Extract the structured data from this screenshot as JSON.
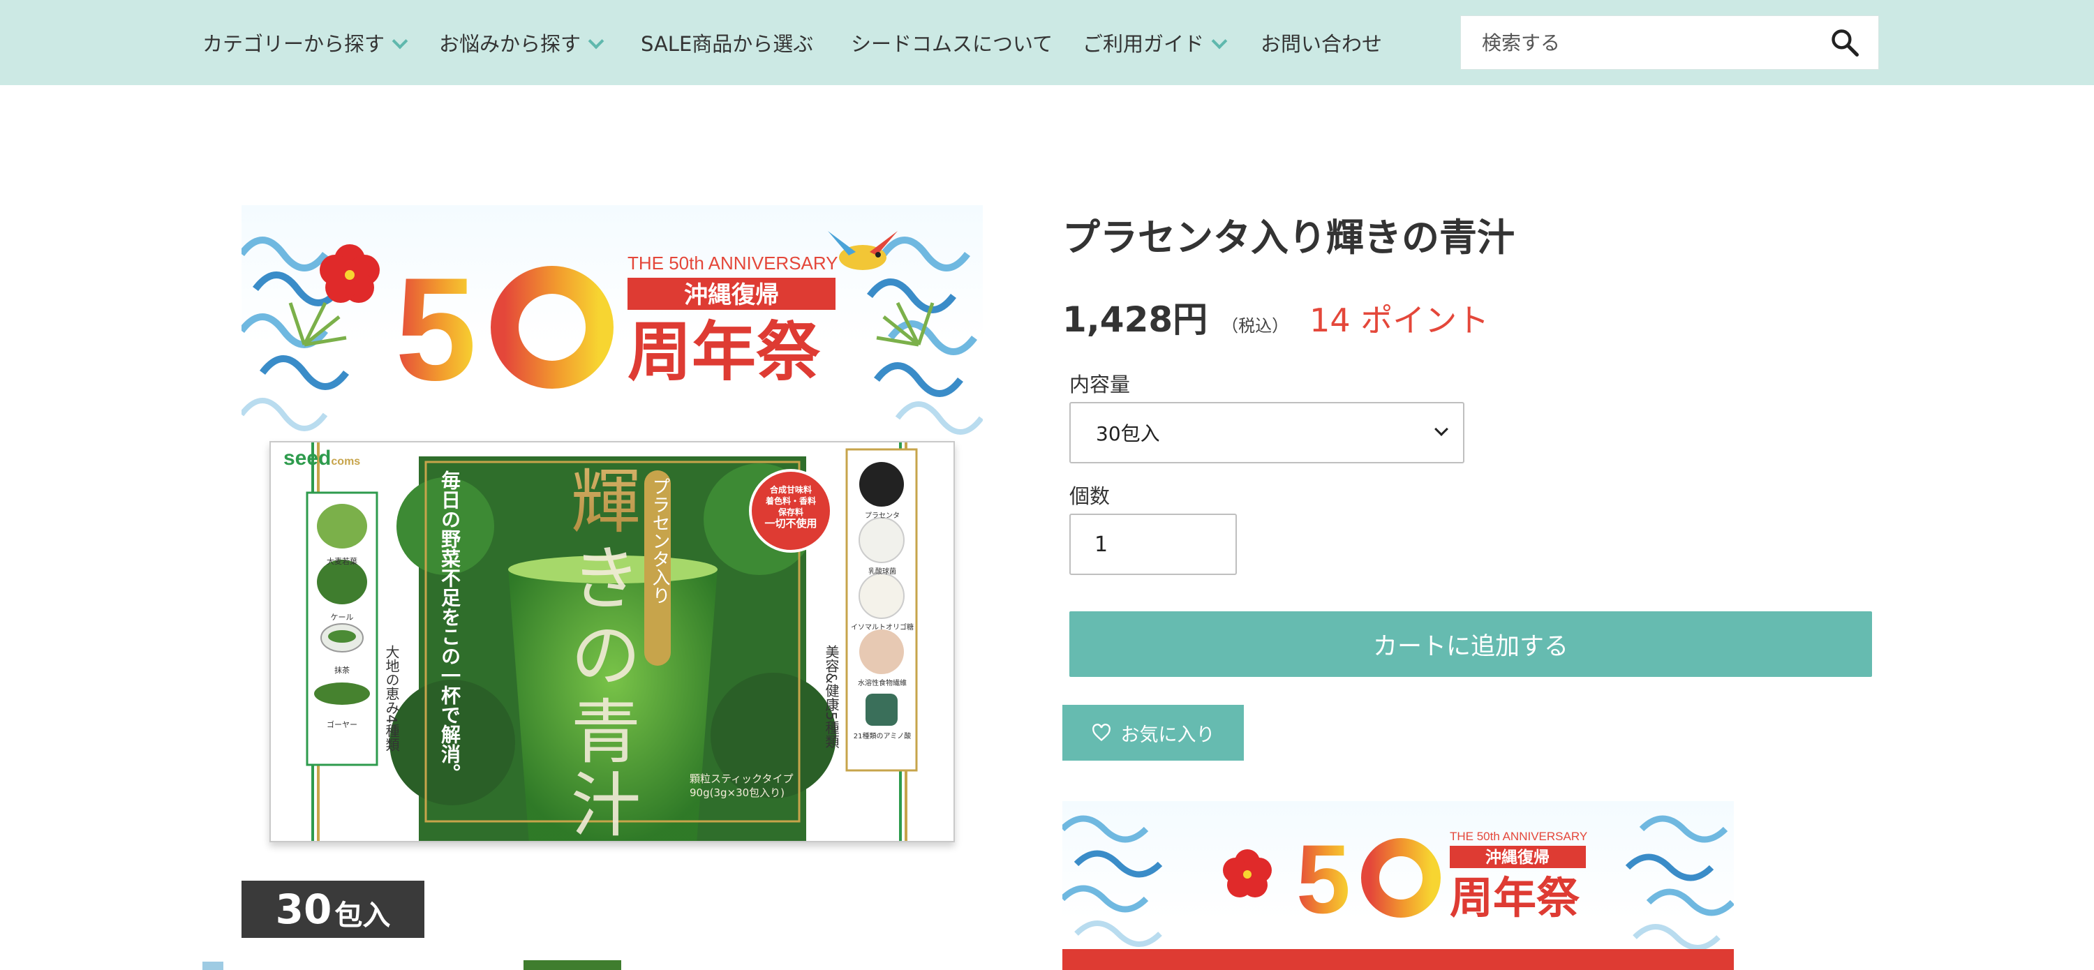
{
  "nav": {
    "items": [
      {
        "label": "カテゴリーから探す",
        "dropdown": true
      },
      {
        "label": "お悩みから探す",
        "dropdown": true
      },
      {
        "label": "SALE商品から選ぶ",
        "dropdown": false
      },
      {
        "label": "シードコムスについて",
        "dropdown": false
      },
      {
        "label": "ご利用ガイド",
        "dropdown": true
      },
      {
        "label": "お問い合わせ",
        "dropdown": false
      }
    ],
    "search_placeholder": "検索する",
    "search_icon": "search-icon"
  },
  "banner": {
    "anniversary": "THE 50th ANNIVERSARY",
    "okinawa": "沖縄復帰",
    "number": "50",
    "festival": "周年祭"
  },
  "package": {
    "brand": "seed",
    "brand_suffix": "coms",
    "product_name": "輝きの青汁",
    "vertical_badge": "プラセンタ入り",
    "tagline": "毎日の野菜不足をこの一杯で解消。",
    "left_ingredients": [
      "大麦若葉",
      "ケール",
      "抹茶",
      "ゴーヤー"
    ],
    "left_caption": "大地の恵み4種類",
    "right_ingredients": [
      "プラセンタ",
      "乳酸球菌",
      "イソマルトオリゴ糖",
      "水溶性食物繊維",
      "21種類のアミノ酸"
    ],
    "right_caption": "美容&健康5種類",
    "seal_lines": [
      "合成甘味料",
      "着色料・香料",
      "保存料",
      "一切不使用"
    ],
    "spec_1": "顆粒スティックタイプ",
    "spec_2": "90g(3g×30包入り)"
  },
  "label_30": {
    "num": "30",
    "unit": "包入"
  },
  "product": {
    "title": "プラセンタ入り輝きの青汁",
    "price": "1,428円",
    "tax": "（税込）",
    "points": "14 ポイント",
    "volume_label": "内容量",
    "volume_value": "30包入",
    "qty_label": "個数",
    "qty_value": "1",
    "cart_button": "カートに追加する",
    "fav_button": "お気に入り"
  },
  "colors": {
    "nav_bg": "#cce9e4",
    "accent": "#66bbb0",
    "points": "#e4473a",
    "banner_red": "#de3b33"
  }
}
